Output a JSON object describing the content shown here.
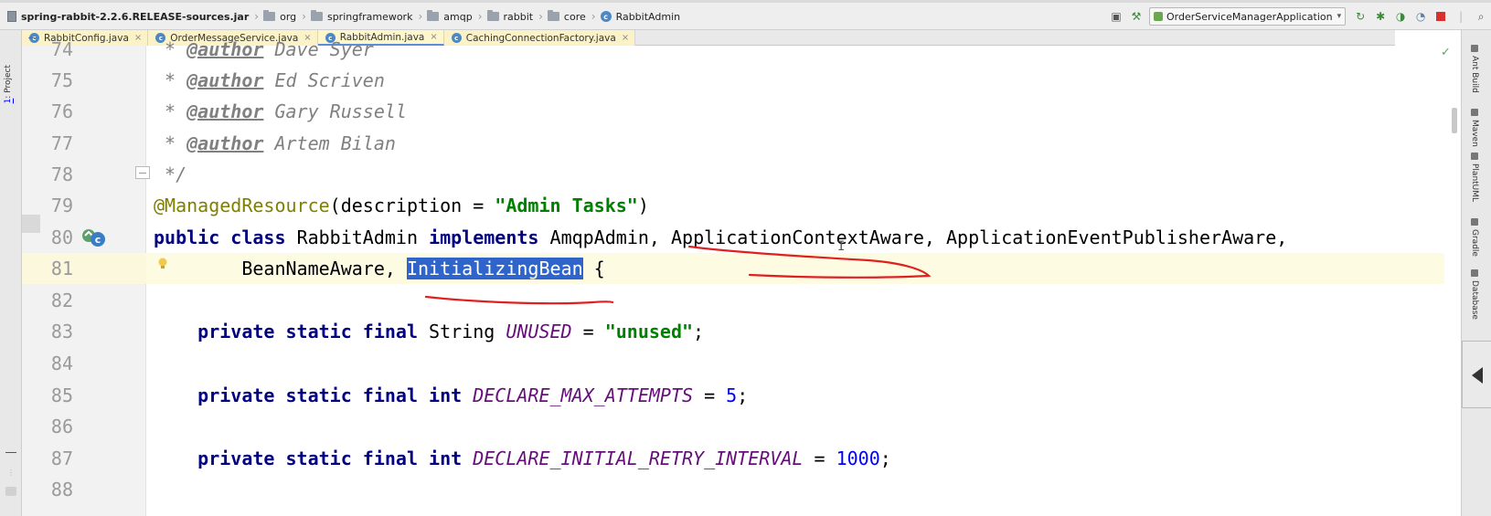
{
  "breadcrumb": [
    {
      "label": "spring-rabbit-2.2.6.RELEASE-sources.jar",
      "icon": "jar-icon"
    },
    {
      "label": "org",
      "icon": "folder-icon"
    },
    {
      "label": "springframework",
      "icon": "folder-icon"
    },
    {
      "label": "amqp",
      "icon": "folder-icon"
    },
    {
      "label": "rabbit",
      "icon": "folder-icon"
    },
    {
      "label": "core",
      "icon": "folder-icon"
    },
    {
      "label": "RabbitAdmin",
      "icon": "class-icon"
    }
  ],
  "toolbar": {
    "run_config": "OrderServiceManagerApplication",
    "icons": [
      "layout-icon",
      "hammer-icon",
      "run-icon",
      "debug-icon",
      "coverage-icon",
      "stop-icon",
      "search-icon",
      "settings-icon"
    ]
  },
  "tabs": [
    {
      "label": "RabbitConfig.java",
      "active": false
    },
    {
      "label": "OrderMessageService.java",
      "active": false
    },
    {
      "label": "RabbitAdmin.java",
      "active": true
    },
    {
      "label": "CachingConnectionFactory.java",
      "active": false
    }
  ],
  "left_tools": {
    "project_number": "1",
    "project_label": ": Project"
  },
  "right_tools": [
    "Ant Build",
    "Maven",
    "PlantUML",
    "Gradle",
    "Database"
  ],
  "code": {
    "lines": [
      {
        "n": "74",
        "author": "Dave Syer"
      },
      {
        "n": "75",
        "author": "Ed Scriven"
      },
      {
        "n": "76",
        "author": "Gary Russell"
      },
      {
        "n": "77",
        "author": "Artem Bilan"
      },
      {
        "n": "78",
        "text": " */"
      },
      {
        "n": "79",
        "annotation": "@ManagedResource",
        "args_pre": "(description = ",
        "str": "\"Admin Tasks\"",
        "args_post": ")"
      },
      {
        "n": "80",
        "kw1": "public",
        "kw2": "class",
        "name": "RabbitAdmin",
        "kw3": "implements",
        "rest": "AmqpAdmin, ApplicationContextAware, ApplicationEventPublisherAware,"
      },
      {
        "n": "81",
        "pre": "BeanNameAware, ",
        "selected": "InitializingBean",
        "post": " {"
      },
      {
        "n": "82"
      },
      {
        "n": "83",
        "mods": "private static final",
        "type": "String",
        "field": "UNUSED",
        "eq": " = ",
        "value": "\"unused\"",
        "end": ";"
      },
      {
        "n": "84"
      },
      {
        "n": "85",
        "mods": "private static final",
        "type": "int",
        "field": "DECLARE_MAX_ATTEMPTS",
        "eq": " = ",
        "value": "5",
        "end": ";"
      },
      {
        "n": "86"
      },
      {
        "n": "87",
        "mods": "private static final",
        "type": "int",
        "field": "DECLARE_INITIAL_RETRY_INTERVAL",
        "eq": " = ",
        "value": "1000",
        "end": ";"
      },
      {
        "n": "88"
      }
    ],
    "author_tag": "@author",
    "star": " * "
  },
  "colors": {
    "keyword": "#000080",
    "string": "#008000",
    "annotation": "#808000",
    "static_field": "#660e7a",
    "number": "#0000ff",
    "selection": "#2f65ca",
    "pen": "#e02020"
  }
}
